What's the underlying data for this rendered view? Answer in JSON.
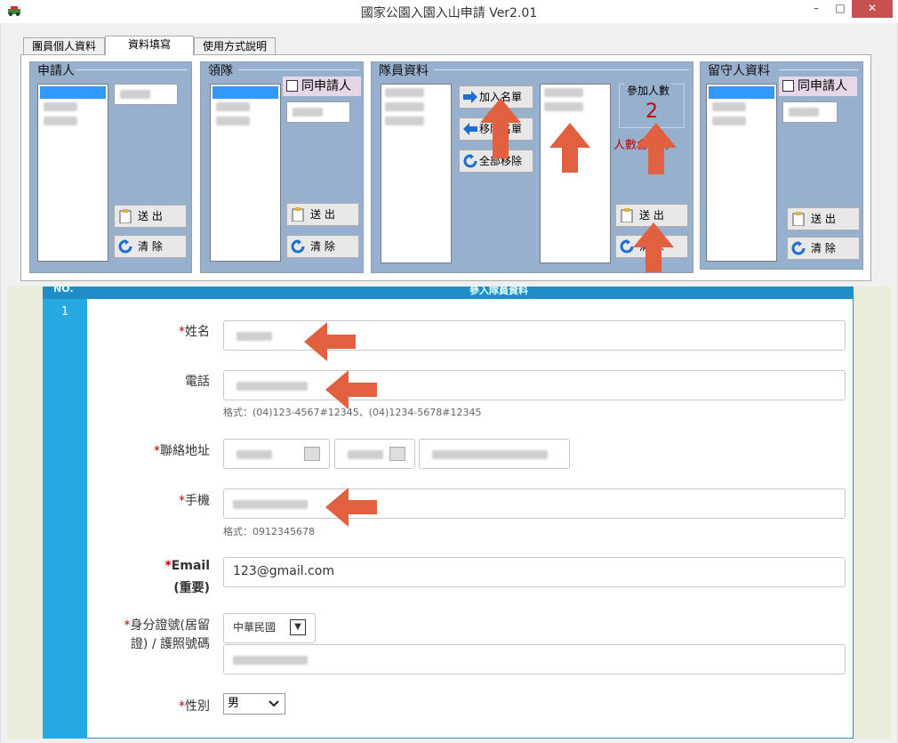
{
  "window": {
    "title": "國家公園入園入山申請 Ver2.01",
    "min": "–",
    "max": "□",
    "close": "✕"
  },
  "tabs": [
    "團員個人資料",
    "資料填寫",
    "使用方式說明"
  ],
  "groups": {
    "applicant": {
      "title": "申請人",
      "send": "送 出",
      "clear": "清 除"
    },
    "leader": {
      "title": "領隊",
      "same": "同申請人",
      "send": "送 出",
      "clear": "清 除"
    },
    "members": {
      "title": "隊員資料",
      "add": "加入名單",
      "remove": "移除名單",
      "remove_all": "全部移除",
      "count_label": "參加人數",
      "count": "2",
      "note": "人數含領隊",
      "send": "送 出",
      "clear": "清 除"
    },
    "stay": {
      "title": "留守人資料",
      "same": "同申請人",
      "send": "送 出",
      "clear": "清 除"
    }
  },
  "form": {
    "header": "NO.",
    "header_title": "參入隊員資料",
    "row_no": "1",
    "name_label": "姓名",
    "phone_label": "電話",
    "phone_hint": "格式：(04)123-4567#12345、(04)1234-5678#12345",
    "address_label": "聯絡地址",
    "mobile_label": "手機",
    "mobile_hint": "格式：0912345678",
    "email_label": "Email",
    "email_note": "(重要)",
    "email_value": "123@gmail.com",
    "id_label_1": "身分證號(居留",
    "id_label_2": "證) / 護照號碼",
    "nationality": "中華民國",
    "gender_label": "性別",
    "gender_value": "男"
  },
  "colors": {
    "group_bg": "#97b0cd",
    "arrow": "#e06040",
    "required": "#c00000",
    "header": "#1f8ec7"
  },
  "icons": [
    "app-icon",
    "arrow-right-icon",
    "arrow-left-icon",
    "refresh-icon",
    "clipboard-icon",
    "checkbox-icon",
    "annotation-arrow-icon"
  ]
}
